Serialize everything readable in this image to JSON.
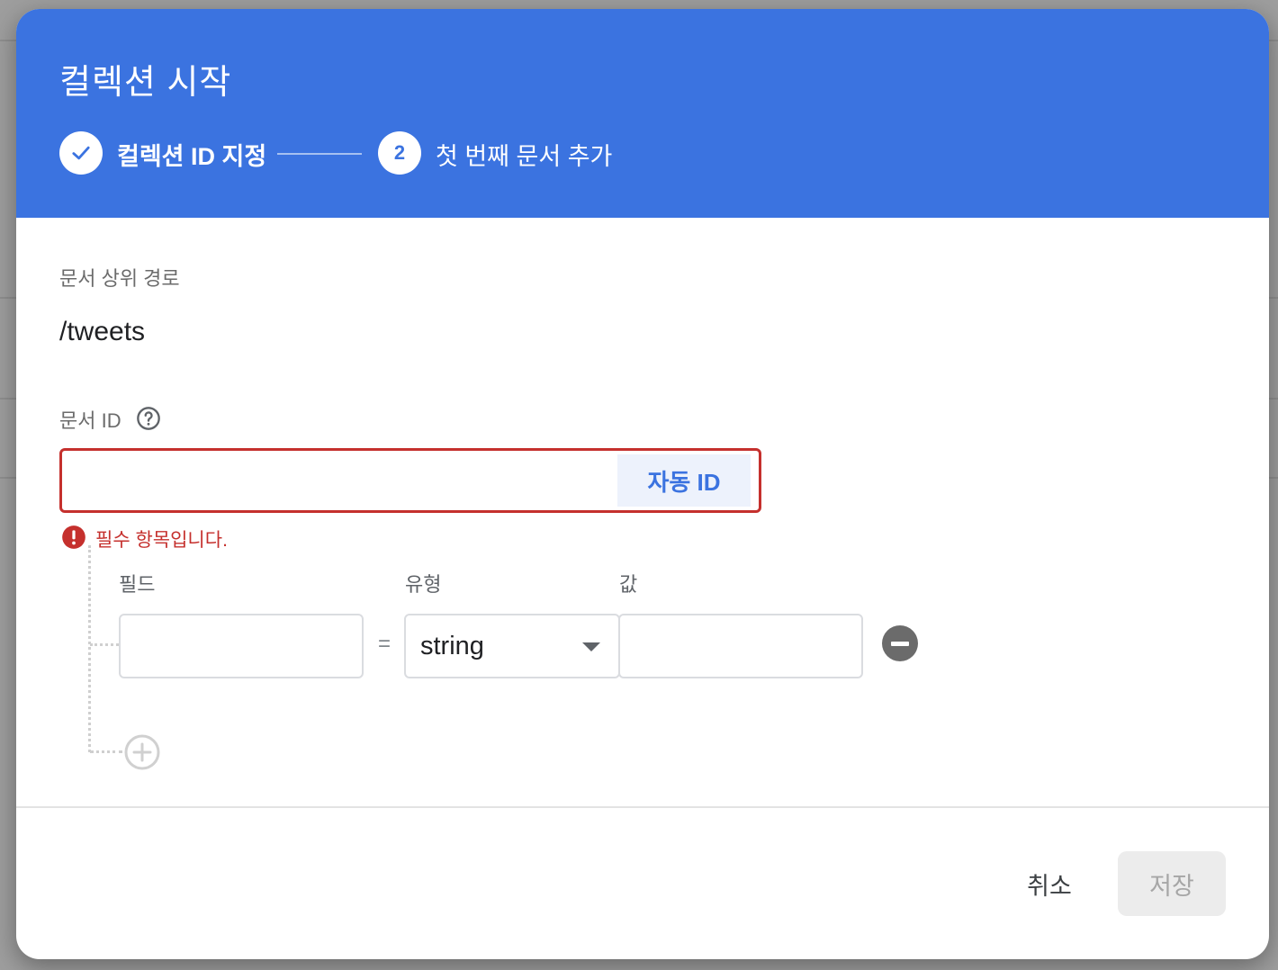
{
  "dialog": {
    "title": "컬렉션 시작"
  },
  "steps": [
    {
      "label": "컬렉션 ID 지정",
      "state": "completed",
      "icon": "check-icon"
    },
    {
      "label": "첫 번째 문서 추가",
      "state": "active",
      "number": "2"
    }
  ],
  "form": {
    "parent_path_label": "문서 상위 경로",
    "parent_path_value": "/tweets",
    "doc_id_label": "문서 ID",
    "doc_id_value": "",
    "auto_id_label": "자동 ID",
    "error_message": "필수 항목입니다.",
    "columns": {
      "field": "필드",
      "type": "유형",
      "value": "값"
    },
    "rows": [
      {
        "field": "",
        "equals": "=",
        "type": "string",
        "value": ""
      }
    ]
  },
  "footer": {
    "cancel_label": "취소",
    "save_label": "저장"
  },
  "colors": {
    "header": "#3b73e0",
    "error": "#c5302d",
    "accent": "#3b73e0"
  }
}
